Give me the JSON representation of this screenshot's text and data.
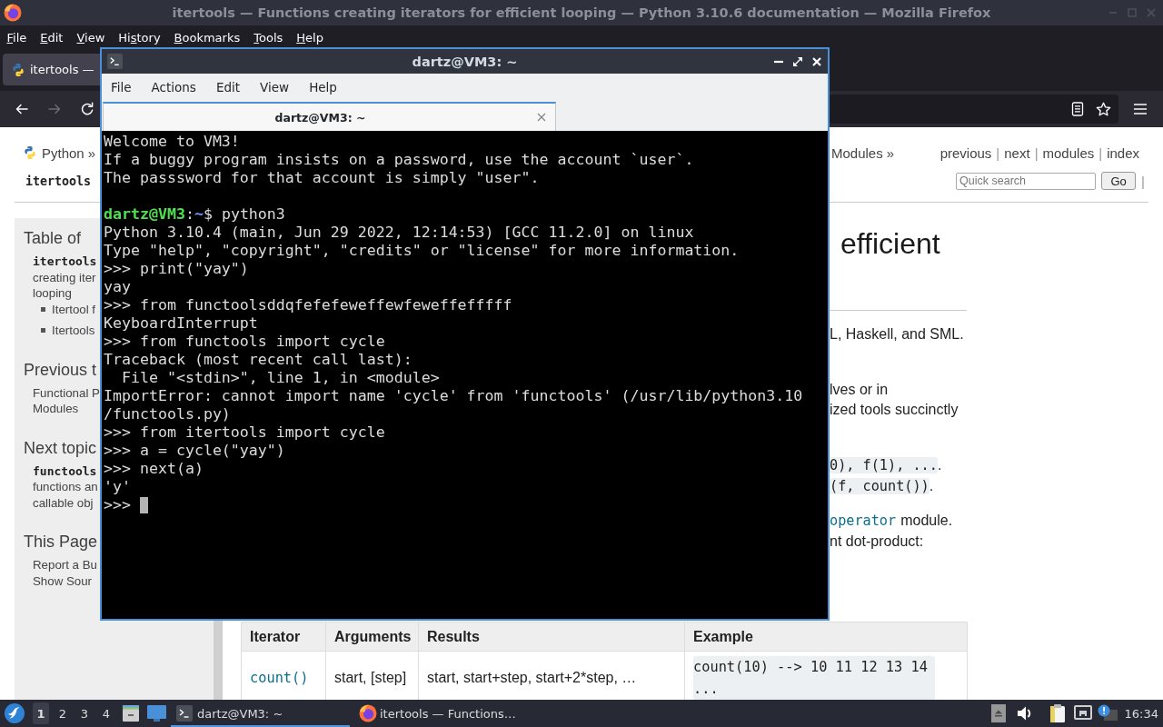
{
  "firefox": {
    "title": "itertools — Functions creating iterators for efficient looping — Python 3.10.6 documentation — Mozilla Firefox",
    "menu": [
      {
        "key": "F",
        "rest": "ile"
      },
      {
        "key": "E",
        "rest": "dit"
      },
      {
        "key": "V",
        "rest": "iew"
      },
      {
        "before": "Hi",
        "key": "s",
        "rest": "tory"
      },
      {
        "key": "B",
        "rest": "ookmarks"
      },
      {
        "key": "T",
        "rest": "ools"
      },
      {
        "key": "H",
        "rest": "elp"
      }
    ],
    "tabs": [
      {
        "label": "itertools —",
        "selected": true
      }
    ],
    "nav_buttons": [
      {
        "kind": "back",
        "disabled": false
      },
      {
        "kind": "forward",
        "disabled": true
      },
      {
        "kind": "reload",
        "disabled": false
      }
    ]
  },
  "doc": {
    "breadcrumb": [
      "Python »",
      "Modules »"
    ],
    "related": [
      {
        "kind": "link",
        "text": "previous"
      },
      {
        "kind": "separator",
        "text": "|"
      },
      {
        "kind": "link",
        "text": "next"
      },
      {
        "kind": "separator",
        "text": "|"
      },
      {
        "kind": "link",
        "text": "modules"
      },
      {
        "kind": "separator",
        "text": "|"
      },
      {
        "kind": "link",
        "text": "index"
      }
    ],
    "page_name": "itertools",
    "search": {
      "placeholder": "Quick search",
      "button": "Go",
      "trailing": "|"
    },
    "sidebar": [
      {
        "heading": "Table of",
        "items": [
          {
            "kind": "code",
            "text": "itertools"
          },
          {
            "kind": "plain",
            "text": "creating iter"
          },
          {
            "kind": "plain",
            "text": "looping"
          },
          {
            "kind": "bullet",
            "text": "Itertool f"
          },
          {
            "kind": "bullet",
            "text": "Itertools"
          }
        ]
      },
      {
        "heading": "Previous t",
        "items": [
          {
            "kind": "plain",
            "text": "Functional P"
          },
          {
            "kind": "plain",
            "text": "Modules"
          }
        ]
      },
      {
        "heading": "Next topic",
        "items": [
          {
            "kind": "code",
            "text": "functools"
          },
          {
            "kind": "plain",
            "text": "functions an"
          },
          {
            "kind": "plain",
            "text": "callable obj"
          }
        ]
      },
      {
        "heading": "This Page",
        "items": [
          {
            "kind": "plain",
            "text": "Report a Bu"
          },
          {
            "kind": "plain",
            "text": "Show Sour"
          }
        ]
      }
    ],
    "heading": "efficient",
    "paragraphs": [
      {
        "lines": [
          [
            {
              "kind": "text",
              "text": "L, Haskell, and SML."
            }
          ]
        ]
      },
      {
        "lines": [
          [
            {
              "kind": "text",
              "text": "lves or in"
            }
          ],
          [
            {
              "kind": "text",
              "text": "ized tools succinctly"
            }
          ]
        ]
      },
      {
        "lines": [
          [
            {
              "kind": "code",
              "text": "0), f(1), ..."
            },
            {
              "kind": "text",
              "text": "."
            }
          ],
          [
            {
              "kind": "code",
              "text": "(f, count())"
            },
            {
              "kind": "text",
              "text": "."
            }
          ]
        ]
      },
      {
        "lines": [
          [
            {
              "kind": "link_code",
              "text": "operator"
            },
            {
              "kind": "text",
              "text": "module."
            }
          ],
          [
            {
              "kind": "text",
              "text": "nt dot-product:"
            }
          ]
        ]
      }
    ],
    "table": {
      "columns": [
        "Iterator",
        "Arguments",
        "Results",
        "Example"
      ],
      "rows": [
        [
          {
            "kind": "link_code",
            "text": "count()"
          },
          {
            "kind": "text",
            "text": "start, [step]"
          },
          {
            "kind": "text",
            "text": "start, start+step, start+2*step, …"
          },
          {
            "kind": "code",
            "text": "count(10) --> 10 11 12 13 14 ..."
          }
        ]
      ]
    }
  },
  "terminal": {
    "title": "dartz@VM3: ~",
    "menu": [
      "File",
      "Actions",
      "Edit",
      "View",
      "Help"
    ],
    "tabs": [
      {
        "label": "dartz@VM3: ~",
        "selected": true
      }
    ],
    "lines": [
      {
        "kind": "output",
        "text": "Welcome to VM3!"
      },
      {
        "kind": "output",
        "text": "If a buggy program insists on a password, use the account `user`."
      },
      {
        "kind": "output",
        "text": "The passsword for that account is simply \"user\"."
      },
      {
        "kind": "blank"
      },
      {
        "kind": "shell",
        "user": "dartz@VM3",
        "separator": ":",
        "path": "~",
        "command": "$ python3"
      },
      {
        "kind": "output",
        "text": "Python 3.10.4 (main, Jun 29 2022, 12:14:53) [GCC 11.2.0] on linux"
      },
      {
        "kind": "output",
        "text": "Type \"help\", \"copyright\", \"credits\" or \"license\" for more information."
      },
      {
        "kind": "output",
        "text": ">>> print(\"yay\")"
      },
      {
        "kind": "output",
        "text": "yay"
      },
      {
        "kind": "output",
        "text": ">>> from functoolsddqfefefeweffewfeweffefffff"
      },
      {
        "kind": "output",
        "text": "KeyboardInterrupt"
      },
      {
        "kind": "output",
        "text": ">>> from functools import cycle"
      },
      {
        "kind": "output",
        "text": "Traceback (most recent call last):"
      },
      {
        "kind": "output",
        "text": "  File \"<stdin>\", line 1, in <module>"
      },
      {
        "kind": "output",
        "text": "ImportError: cannot import name 'cycle' from 'functools' (/usr/lib/python3.10"
      },
      {
        "kind": "output",
        "text": "/functools.py)"
      },
      {
        "kind": "output",
        "text": ">>> from itertools import cycle"
      },
      {
        "kind": "output",
        "text": ">>> a = cycle(\"yay\")"
      },
      {
        "kind": "output",
        "text": ">>> next(a)"
      },
      {
        "kind": "output",
        "text": "'y'"
      },
      {
        "kind": "output",
        "text": ">>>"
      }
    ],
    "cursor": true
  },
  "taskbar": {
    "workspaces": [
      {
        "label": "1",
        "selected": true
      },
      {
        "label": "2",
        "selected": false
      },
      {
        "label": "3",
        "selected": false
      },
      {
        "label": "4",
        "selected": false
      }
    ],
    "tasks": [
      {
        "kind": "terminal",
        "label": "dartz@VM3: ~",
        "selected": true
      },
      {
        "kind": "browser",
        "label": "itertools — Functions…",
        "selected": false
      }
    ],
    "clock": "16:34"
  }
}
